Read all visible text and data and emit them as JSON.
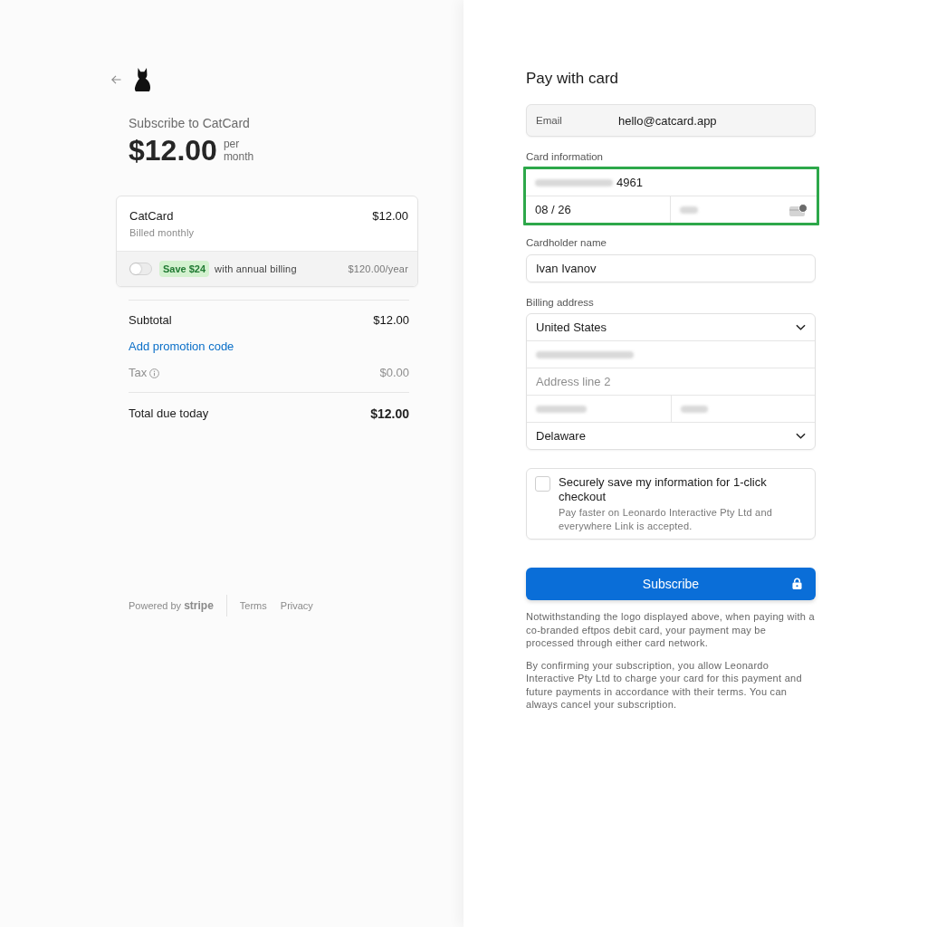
{
  "header": {
    "title": "Subscribe to CatCard",
    "price": "$12.00",
    "period": "per month"
  },
  "plan": {
    "name": "CatCard",
    "billing": "Billed monthly",
    "price": "$12.00",
    "annual_offer": {
      "on": false,
      "badge": "Save $24",
      "text": "with annual billing",
      "price": "$120.00/year"
    }
  },
  "summary": {
    "subtotal": {
      "label": "Subtotal",
      "value": "$12.00"
    },
    "promotion_link": "Add promotion code",
    "tax": {
      "label": "Tax",
      "value": "$0.00"
    },
    "total": {
      "label": "Total due today",
      "value": "$12.00"
    }
  },
  "footer": {
    "powered_by": "Powered by **stripe**",
    "links": [
      "Terms",
      "Privacy"
    ]
  },
  "payment": {
    "title": "Pay with card",
    "email": {
      "label": "Email",
      "value": "hello@catcard.app"
    },
    "card_information": {
      "label": "Card information",
      "highlighted": true,
      "number": "4961",
      "expiry": "08 / 26"
    },
    "cardholder": {
      "label": "Cardholder name",
      "value": "Ivan Ivanov"
    },
    "billing_address": {
      "label": "Billing address",
      "fields": [
        {
          "kind": "select",
          "value": "United States"
        },
        {
          "kind": "blurred"
        },
        {
          "kind": "input",
          "placeholder": "Address line 2"
        },
        {
          "kind": "blurred_pair"
        },
        {
          "kind": "select",
          "value": "Delaware"
        }
      ]
    }
  },
  "save_info": {
    "checked": false,
    "title": "Securely save my information for 1-click checkout",
    "description": "Pay faster on Leonardo Interactive Pty Ltd and everywhere Link is accepted."
  },
  "subscribe_button": "Subscribe",
  "notices": [
    "Notwithstanding the logo displayed above, when paying with a co-branded eftpos debit card, your payment may be processed through either card network.",
    "By confirming your subscription, you allow Leonardo Interactive Pty Ltd to charge your card for this payment and future payments in accordance with their terms. You can always cancel your subscription."
  ]
}
